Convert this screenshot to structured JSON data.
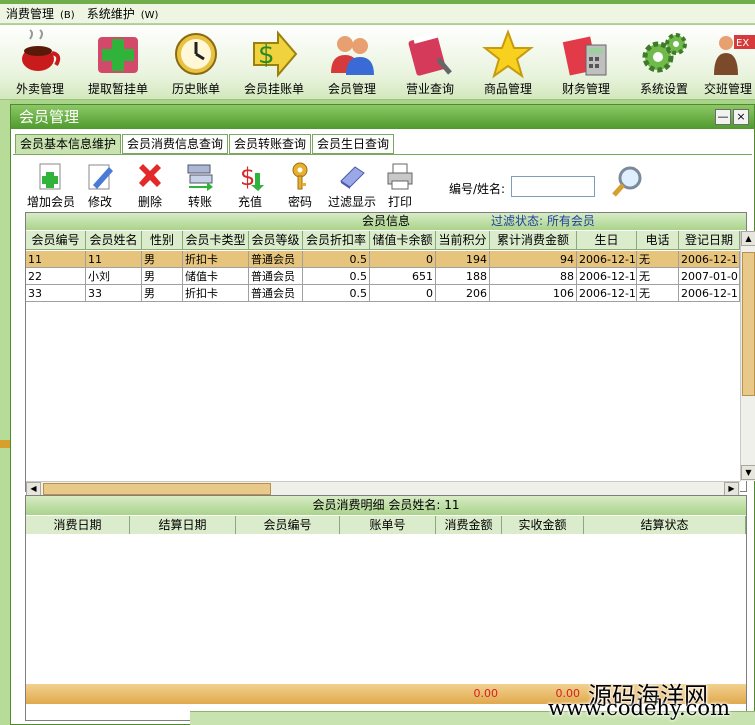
{
  "menubar": [
    {
      "label": "消费管理",
      "accel": "(B)"
    },
    {
      "label": "系统维护",
      "accel": "(W)"
    }
  ],
  "toolbar": [
    {
      "label": "外卖管理",
      "icon": "coffee-cup-icon"
    },
    {
      "label": "提取暂挂单",
      "icon": "green-plus-icon"
    },
    {
      "label": "历史账单",
      "icon": "clock-icon"
    },
    {
      "label": "会员挂账单",
      "icon": "dollar-arrow-icon"
    },
    {
      "label": "会员管理",
      "icon": "users-icon"
    },
    {
      "label": "营业查询",
      "icon": "book-search-icon"
    },
    {
      "label": "商品管理",
      "icon": "star-icon"
    },
    {
      "label": "财务管理",
      "icon": "calculator-icon"
    },
    {
      "label": "系统设置",
      "icon": "gears-icon"
    },
    {
      "label": "交班管理",
      "icon": "exit-icon"
    }
  ],
  "window": {
    "title": "会员管理",
    "minimize": "—",
    "close": "×"
  },
  "tabs": [
    "会员基本信息维护",
    "会员消费信息查询",
    "会员转账查询",
    "会员生日查询"
  ],
  "tools": [
    {
      "label": "增加会员",
      "icon": "add-member-icon"
    },
    {
      "label": "修改",
      "icon": "edit-icon"
    },
    {
      "label": "删除",
      "icon": "delete-icon"
    },
    {
      "label": "转账",
      "icon": "transfer-icon"
    },
    {
      "label": "充值",
      "icon": "recharge-icon"
    },
    {
      "label": "密码",
      "icon": "key-icon"
    },
    {
      "label": "过滤显示",
      "icon": "filter-icon"
    },
    {
      "label": "打印",
      "icon": "printer-icon"
    }
  ],
  "search": {
    "label": "编号/姓名:",
    "value": ""
  },
  "members": {
    "caption": "会员信息",
    "filter_status": "过滤状态: 所有会员",
    "columns": [
      "会员编号",
      "会员姓名",
      "性别",
      "会员卡类型",
      "会员等级",
      "会员折扣率",
      "储值卡余额",
      "当前积分",
      "累计消费金额",
      "生日",
      "电话",
      "登记日期"
    ],
    "rows": [
      [
        "11",
        "11",
        "男",
        "折扣卡",
        "普通会员",
        "0.5",
        "0",
        "194",
        "94",
        "2006-12-1",
        "无",
        "2006-12-1"
      ],
      [
        "22",
        "小刘",
        "男",
        "储值卡",
        "普通会员",
        "0.5",
        "651",
        "188",
        "88",
        "2006-12-1",
        "无",
        "2007-01-0"
      ],
      [
        "33",
        "33",
        "男",
        "折扣卡",
        "普通会员",
        "0.5",
        "0",
        "206",
        "106",
        "2006-12-1",
        "无",
        "2006-12-1"
      ]
    ]
  },
  "details": {
    "caption": "会员消费明细 会员姓名:  11",
    "columns": [
      "消费日期",
      "结算日期",
      "会员编号",
      "账单号",
      "消费金额",
      "实收金额",
      "结算状态"
    ],
    "totals": [
      "0.00",
      "0.00"
    ]
  },
  "watermark": {
    "line1": "源码海洋网",
    "line2": "www.codehy.com"
  },
  "colors": {
    "accent": "#4f9a2e",
    "selected_row": "#e7c47c",
    "total_text": "#d61f1f"
  }
}
